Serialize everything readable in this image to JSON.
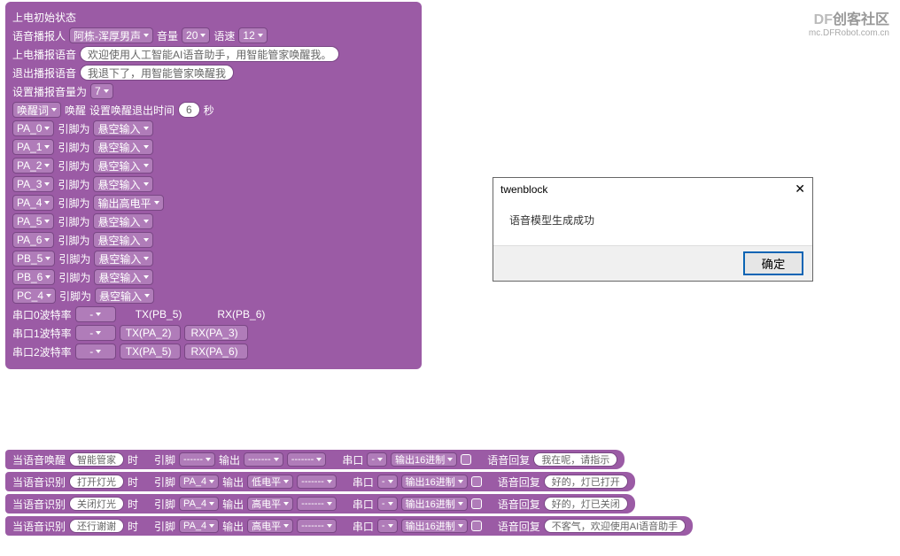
{
  "watermark": {
    "prefix": "DF",
    "suffix": "创客社区",
    "url": "mc.DFRobot.com.cn"
  },
  "panel": {
    "title": "上电初始状态",
    "voice_person_lbl": "语音播报人",
    "voice_person_val": "阿栋-浑厚男声",
    "volume_lbl": "音量",
    "volume_val": "20",
    "speed_lbl": "语速",
    "speed_val": "12",
    "boot_voice_lbl": "上电播报语音",
    "boot_voice_val": "欢迎使用人工智能AI语音助手，用智能管家唤醒我。",
    "exit_voice_lbl": "退出播报语音",
    "exit_voice_val": "我退下了，用智能管家唤醒我",
    "set_vol_lbl": "设置播报音量为",
    "set_vol_val": "7",
    "wake_word_lbl": "唤醒词",
    "wake_word_val": "唤醒",
    "wake_exit_lbl": "设置唤醒退出时间",
    "wake_exit_val": "6",
    "wake_exit_unit": "秒",
    "pin_lbl": "引脚为",
    "pins": [
      {
        "name": "PA_0",
        "mode": "悬空输入"
      },
      {
        "name": "PA_1",
        "mode": "悬空输入"
      },
      {
        "name": "PA_2",
        "mode": "悬空输入"
      },
      {
        "name": "PA_3",
        "mode": "悬空输入"
      },
      {
        "name": "PA_4",
        "mode": "输出高电平"
      },
      {
        "name": "PA_5",
        "mode": "悬空输入"
      },
      {
        "name": "PA_6",
        "mode": "悬空输入"
      },
      {
        "name": "PB_5",
        "mode": "悬空输入"
      },
      {
        "name": "PB_6",
        "mode": "悬空输入"
      },
      {
        "name": "PC_4",
        "mode": "悬空输入"
      }
    ],
    "serials": [
      {
        "label": "串口0波特率",
        "baud": "-",
        "tx": "TX(PB_5)",
        "rx": "RX(PB_6)",
        "plain": true
      },
      {
        "label": "串口1波特率",
        "baud": "-",
        "tx": "TX(PA_2)",
        "rx": "RX(PA_3)",
        "plain": false
      },
      {
        "label": "串口2波特率",
        "baud": "-",
        "tx": "TX(PA_5)",
        "rx": "RX(PA_6)",
        "plain": false
      }
    ]
  },
  "events": [
    {
      "trigger": "当语音唤醒",
      "word": "智能管家",
      "pin": "------",
      "out": "-------",
      "ser": "-",
      "reply": "我在呢，请指示"
    },
    {
      "trigger": "当语音识别",
      "word": "打开灯光",
      "pin": "PA_4",
      "out": "低电平",
      "ser": "-",
      "reply": "好的，灯已打开"
    },
    {
      "trigger": "当语音识别",
      "word": "关闭灯光",
      "pin": "PA_4",
      "out": "高电平",
      "ser": "-",
      "reply": "好的，灯已关闭"
    },
    {
      "trigger": "当语音识别",
      "word": "还行谢谢",
      "pin": "PA_4",
      "out": "高电平",
      "ser": "-",
      "reply": "不客气，欢迎使用AI语音助手"
    }
  ],
  "ev_labels": {
    "shi": "时",
    "pin": "引脚",
    "out": "输出",
    "dash": "-------",
    "serial": "串口",
    "hex": "输出16进制",
    "reply": "语音回复"
  },
  "dialog": {
    "title": "twenblock",
    "message": "语音模型生成成功",
    "ok": "确定"
  }
}
